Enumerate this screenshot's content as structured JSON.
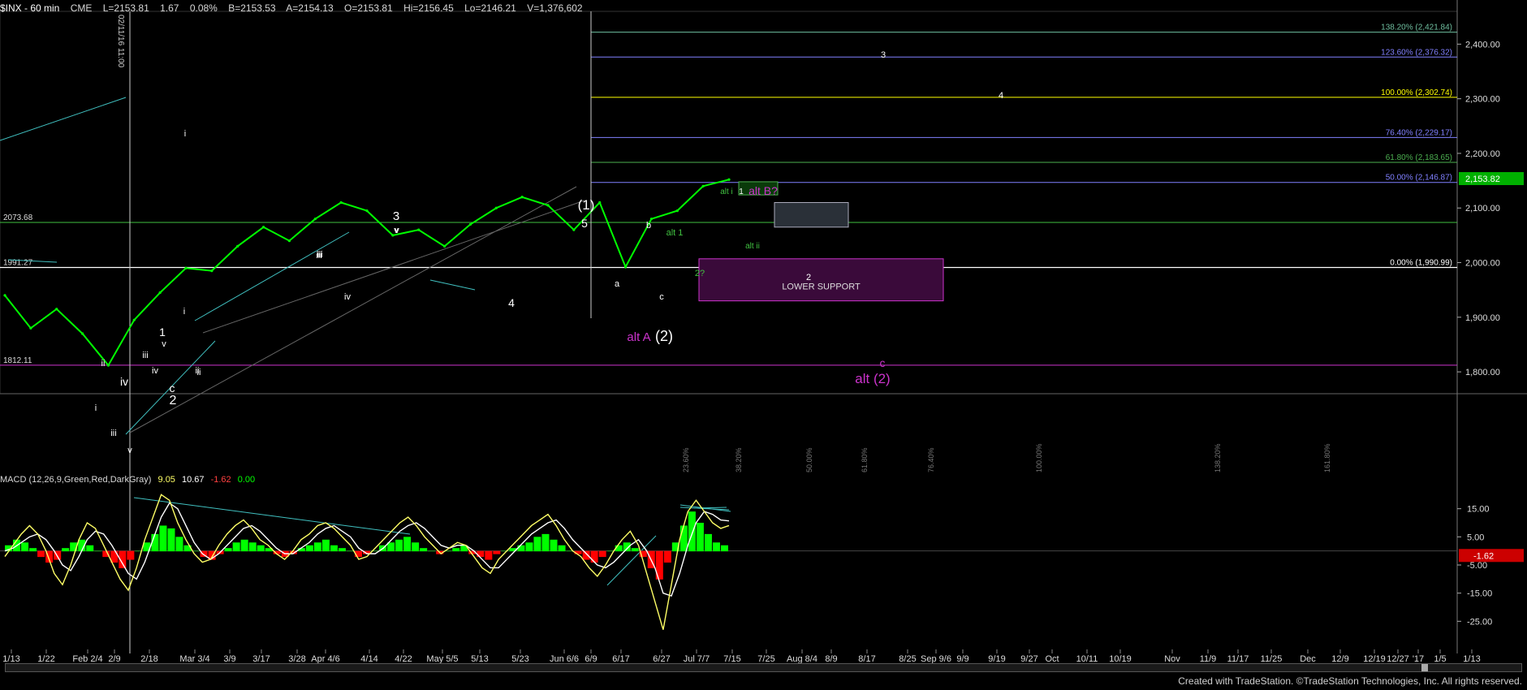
{
  "header": {
    "symbol": "$INX - 60 min",
    "exchange": "CME",
    "last": "L=2153.81",
    "change": "1.67",
    "change_pct": "0.08%",
    "bid": "B=2153.53",
    "ask": "A=2154.13",
    "open": "O=2153.81",
    "high": "Hi=2156.45",
    "low": "Lo=2146.21",
    "volume": "V=1,376,602"
  },
  "macd_header": {
    "title": "MACD (12,26,9,Green,Red,DarkGray)",
    "macd": "9.05",
    "signal": "10.67",
    "diff": "-1.62",
    "zero": "0.00"
  },
  "credit": "Created with TradeStation. ©TradeStation Technologies, Inc. All rights reserved.",
  "colors": {
    "background": "#000000",
    "price_line": "#00ff00",
    "fib_blue": "#8080ff",
    "fib_green": "#4caf50",
    "fib_yellow": "#ffff00",
    "fib_teal": "#6fbf9f",
    "support_magenta": "#cc33cc",
    "trendline_cyan": "#40c0c0",
    "macd_green": "#00ff00",
    "macd_red": "#ff0000",
    "macd_line_white": "#ffffff",
    "macd_line_yellow": "#ffff66"
  },
  "chart_data": {
    "type": "line",
    "title": "$INX - 60 min",
    "price_axis": {
      "ylim": [
        1760,
        2460
      ],
      "ticks": [
        "2,400.00",
        "2,300.00",
        "2,200.00",
        "2,100.00",
        "2,000.00",
        "1,900.00",
        "1,800.00"
      ]
    },
    "last_price_label": "2,153.82",
    "x_axis_labels": [
      "1/13",
      "1/22",
      "Feb 2/4",
      "2/9",
      "2/18",
      "Mar 3/4",
      "3/9",
      "3/17",
      "3/28",
      "Apr 4/6",
      "4/14",
      "4/22",
      "May 5/5",
      "5/13",
      "5/23",
      "Jun 6/6",
      "6/9",
      "6/17",
      "6/27",
      "Jul 7/7",
      "7/15",
      "7/25",
      "Aug 8/4",
      "8/9",
      "8/17",
      "8/25",
      "Sep 9/6",
      "9/9",
      "9/19",
      "9/27",
      "Oct",
      "10/11",
      "10/19",
      "Nov",
      "11/9",
      "11/17",
      "11/25",
      "Dec",
      "12/9",
      "12/19",
      "12/27",
      "'17",
      "1/5",
      "1/13"
    ],
    "price_series": {
      "name": "",
      "x": [
        "1/13",
        "1/22",
        "2/4",
        "2/9",
        "2/11",
        "2/18",
        "2/22",
        "3/4",
        "3/9",
        "3/17",
        "3/28",
        "4/6",
        "4/14",
        "4/20",
        "4/22",
        "5/5",
        "5/13",
        "5/19",
        "5/23",
        "6/6",
        "6/8",
        "6/9",
        "6/17",
        "6/23",
        "6/27",
        "7/1",
        "7/7",
        "7/11",
        "7/13"
      ],
      "values": [
        1940,
        1880,
        1915,
        1870,
        1812,
        1895,
        1945,
        1990,
        1985,
        2030,
        2065,
        2040,
        2080,
        2110,
        2095,
        2050,
        2060,
        2030,
        2070,
        2100,
        2120,
        2105,
        2060,
        2110,
        1992,
        2080,
        2095,
        2140,
        2152
      ]
    },
    "horizontal_levels": [
      {
        "label": "138.20% (2,421.84)",
        "value": 2421.84
      },
      {
        "label": "123.60% (2,376.32)",
        "value": 2376.32
      },
      {
        "label": "100.00% (2,302.74)",
        "value": 2302.74
      },
      {
        "label": "76.40% (2,229.17)",
        "value": 2229.17
      },
      {
        "label": "61.80% (2,183.65)",
        "value": 2183.65
      },
      {
        "label": "50.00% (2,146.87)",
        "value": 2146.87
      },
      {
        "label": "0.00% (1,990.99)",
        "value": 1990.99
      }
    ],
    "left_levels": [
      {
        "label": "2073.68",
        "value": 2073.68
      },
      {
        "label": "1991.27",
        "value": 1991.27
      },
      {
        "label": "1812.11",
        "value": 1812.11
      }
    ],
    "time_fib_labels": [
      "23.60%",
      "38.20%",
      "50.00%",
      "61.80%",
      "76.40%",
      "100.00%",
      "138.20%",
      "161.80%"
    ],
    "vertical_label": "02/11/16 11:00",
    "boxes": [
      {
        "label": "",
        "y_range": [
          2124,
          2148
        ]
      },
      {
        "label": "",
        "y_range": [
          2065,
          2110
        ]
      },
      {
        "label": "LOWER SUPPORT",
        "y_range": [
          1930,
          2007
        ]
      }
    ],
    "wave_labels": [
      "(1)",
      "5",
      "3",
      "v",
      "iii",
      "iv",
      "4",
      "i",
      "1",
      "v",
      "c",
      "2",
      "ii",
      "iii",
      "iv",
      "v",
      "i",
      "ii",
      "iii",
      "iv",
      "i",
      "ii",
      "iii",
      "v",
      "b",
      "a",
      "c",
      "alt A",
      "(2)",
      "alt 1",
      "2?",
      "alt i",
      "1",
      "alt B?",
      "alt ii",
      "2",
      "3",
      "4",
      "c",
      "alt (2)"
    ],
    "macd": {
      "ylim": [
        -35,
        25
      ],
      "ticks": [
        "15.00",
        "5.00",
        "-5.00",
        "-15.00",
        "-25.00"
      ],
      "last_value_label": "-1.62",
      "histogram": [
        2,
        4,
        3,
        1,
        -2,
        -4,
        -3,
        1,
        3,
        4,
        2,
        0,
        -2,
        -4,
        -6,
        -3,
        0,
        3,
        6,
        9,
        8,
        5,
        2,
        0,
        -2,
        -3,
        -1,
        1,
        3,
        4,
        3,
        2,
        1,
        -1,
        -2,
        -1,
        1,
        2,
        3,
        4,
        2,
        1,
        0,
        -2,
        -1,
        0,
        2,
        3,
        4,
        5,
        3,
        1,
        0,
        -1,
        0,
        1,
        2,
        -1,
        -2,
        -3,
        -1,
        0,
        1,
        2,
        3,
        5,
        6,
        4,
        2,
        0,
        -1,
        -3,
        -4,
        -2,
        0,
        2,
        3,
        1,
        -2,
        -6,
        -10,
        -4,
        3,
        9,
        14,
        10,
        6,
        3,
        2
      ],
      "macd_line": [
        -2,
        2,
        6,
        9,
        6,
        0,
        -8,
        -12,
        -5,
        4,
        10,
        8,
        2,
        -4,
        -10,
        -14,
        -6,
        4,
        12,
        20,
        18,
        10,
        4,
        -1,
        -4,
        -3,
        2,
        6,
        9,
        11,
        8,
        4,
        2,
        -1,
        -3,
        0,
        4,
        6,
        9,
        10,
        8,
        5,
        2,
        -3,
        -2,
        1,
        4,
        7,
        10,
        12,
        9,
        5,
        2,
        -1,
        1,
        3,
        2,
        -2,
        -6,
        -8,
        -3,
        0,
        3,
        6,
        9,
        11,
        13,
        9,
        4,
        0,
        -2,
        -6,
        -9,
        -5,
        0,
        4,
        7,
        2,
        -8,
        -18,
        -28,
        -12,
        4,
        14,
        18,
        14,
        10,
        8,
        9
      ],
      "signal_line": [
        0,
        1,
        3,
        5,
        6,
        4,
        0,
        -5,
        -7,
        -2,
        4,
        7,
        6,
        2,
        -3,
        -8,
        -10,
        -4,
        4,
        12,
        17,
        15,
        9,
        3,
        -1,
        -3,
        -1,
        2,
        5,
        8,
        9,
        7,
        4,
        1,
        -1,
        -1,
        1,
        3,
        6,
        8,
        9,
        7,
        5,
        1,
        -1,
        -1,
        1,
        4,
        7,
        9,
        10,
        8,
        5,
        2,
        1,
        2,
        2,
        0,
        -3,
        -6,
        -6,
        -3,
        0,
        3,
        6,
        8,
        10,
        11,
        8,
        4,
        1,
        -2,
        -5,
        -6,
        -4,
        -1,
        2,
        4,
        0,
        -6,
        -15,
        -16,
        -8,
        2,
        10,
        14,
        13,
        11,
        10.67
      ]
    }
  }
}
